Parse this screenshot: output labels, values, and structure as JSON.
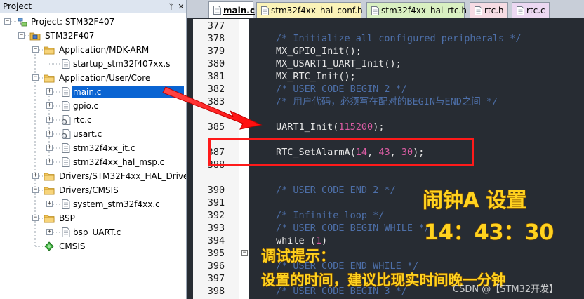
{
  "project_panel": {
    "title": "Project",
    "pin_glyph": "ᛘ",
    "close_glyph": "✕",
    "tree": [
      {
        "label": "Project: STM32F407",
        "depth": 0,
        "icon": "project-icon",
        "toggle": "−"
      },
      {
        "label": "STM32F407",
        "depth": 1,
        "icon": "target-icon",
        "toggle": "−"
      },
      {
        "label": "Application/MDK-ARM",
        "depth": 2,
        "icon": "folder-icon",
        "toggle": "−"
      },
      {
        "label": "startup_stm32f407xx.s",
        "depth": 3,
        "icon": "file-icon",
        "toggle": ""
      },
      {
        "label": "Application/User/Core",
        "depth": 2,
        "icon": "folder-icon",
        "toggle": "−"
      },
      {
        "label": "main.c",
        "depth": 3,
        "icon": "file-icon",
        "toggle": "+",
        "selected": true
      },
      {
        "label": "gpio.c",
        "depth": 3,
        "icon": "file-icon",
        "toggle": "+"
      },
      {
        "label": "rtc.c",
        "depth": 3,
        "icon": "file-gear-icon",
        "toggle": "+"
      },
      {
        "label": "usart.c",
        "depth": 3,
        "icon": "file-gear-icon",
        "toggle": "+"
      },
      {
        "label": "stm32f4xx_it.c",
        "depth": 3,
        "icon": "file-icon",
        "toggle": "+"
      },
      {
        "label": "stm32f4xx_hal_msp.c",
        "depth": 3,
        "icon": "file-icon",
        "toggle": "+"
      },
      {
        "label": "Drivers/STM32F4xx_HAL_Driver",
        "depth": 2,
        "icon": "folder-icon",
        "toggle": "+"
      },
      {
        "label": "Drivers/CMSIS",
        "depth": 2,
        "icon": "folder-icon",
        "toggle": "−"
      },
      {
        "label": "system_stm32f4xx.c",
        "depth": 3,
        "icon": "file-icon",
        "toggle": "+"
      },
      {
        "label": "BSP",
        "depth": 2,
        "icon": "folder-icon",
        "toggle": "−"
      },
      {
        "label": "bsp_UART.c",
        "depth": 3,
        "icon": "file-icon",
        "toggle": "+"
      },
      {
        "label": "CMSIS",
        "depth": 2,
        "icon": "cmsis-icon",
        "toggle": ""
      }
    ]
  },
  "tabs": [
    {
      "label": "main.c",
      "active": true,
      "bg": "#ffffff"
    },
    {
      "label": "stm32f4xx_hal_conf.h",
      "active": false,
      "bg": "#fbf3b8"
    },
    {
      "label": "stm32f4xx_hal_rtc.h",
      "active": false,
      "bg": "#d9f0c2"
    },
    {
      "label": "rtc.h",
      "active": false,
      "bg": "#f6dce4"
    },
    {
      "label": "rtc.c",
      "active": false,
      "bg": "#ecd8f2"
    }
  ],
  "editor": {
    "lines": [
      {
        "n": "377",
        "code": []
      },
      {
        "n": "378",
        "code": [
          [
            "c",
            "/* Initialize all configured peripherals */"
          ]
        ]
      },
      {
        "n": "379",
        "code": [
          [
            "t",
            "MX_GPIO_Init();"
          ]
        ]
      },
      {
        "n": "380",
        "code": [
          [
            "t",
            "MX_USART1_UART_Init();"
          ]
        ]
      },
      {
        "n": "381",
        "code": [
          [
            "t",
            "MX_RTC_Init();"
          ]
        ]
      },
      {
        "n": "382",
        "code": [
          [
            "c",
            "/* USER CODE BEGIN 2 */"
          ]
        ]
      },
      {
        "n": "383",
        "code": [
          [
            "c",
            "/* 用户代码，必须写在配对的BEGIN与END之间 */"
          ]
        ]
      },
      {
        "n": "",
        "code": []
      },
      {
        "n": "385",
        "code": [
          [
            "t",
            "UART1_Init("
          ],
          [
            "n",
            "115200"
          ],
          [
            "t",
            ");"
          ]
        ]
      },
      {
        "n": "",
        "code": []
      },
      {
        "n": "387",
        "code": [
          [
            "t",
            "RTC_SetAlarmA("
          ],
          [
            "n",
            "14"
          ],
          [
            "t",
            ", "
          ],
          [
            "n",
            "43"
          ],
          [
            "t",
            ", "
          ],
          [
            "n",
            "30"
          ],
          [
            "t",
            ");"
          ]
        ]
      },
      {
        "n": "388",
        "code": []
      },
      {
        "n": "",
        "code": []
      },
      {
        "n": "390",
        "code": [
          [
            "c",
            "/* USER CODE END 2 */"
          ]
        ]
      },
      {
        "n": "391",
        "code": []
      },
      {
        "n": "392",
        "code": [
          [
            "c",
            "/* Infinite loop */"
          ]
        ]
      },
      {
        "n": "393",
        "code": [
          [
            "c",
            "/* USER CODE BEGIN WHILE */"
          ]
        ]
      },
      {
        "n": "394",
        "code": [
          [
            "t",
            "while ("
          ],
          [
            "n",
            "1"
          ],
          [
            "t",
            ")"
          ]
        ]
      },
      {
        "n": "395",
        "code": []
      },
      {
        "n": "396",
        "code": [
          [
            "c",
            "/* USER CODE END WHILE */"
          ]
        ]
      },
      {
        "n": "397",
        "code": []
      },
      {
        "n": "398",
        "code": [
          [
            "c",
            "/* USER CODE BEGIN 3 */"
          ]
        ]
      }
    ],
    "fold_line": "395"
  },
  "annotations": {
    "alarm_title": "闹钟A 设置",
    "alarm_time": "14：43：30",
    "tip_title": "调试提示：",
    "tip_body": "设置的时间，建议比现实时间晚一分钟",
    "watermark": "CSDN @【STM32开发】"
  },
  "colors": {
    "annotation_yellow": "#ffd21f",
    "arrow_red": "#ff1a1a",
    "selection_blue": "#0a64d2",
    "editor_bg": "#272c33"
  }
}
